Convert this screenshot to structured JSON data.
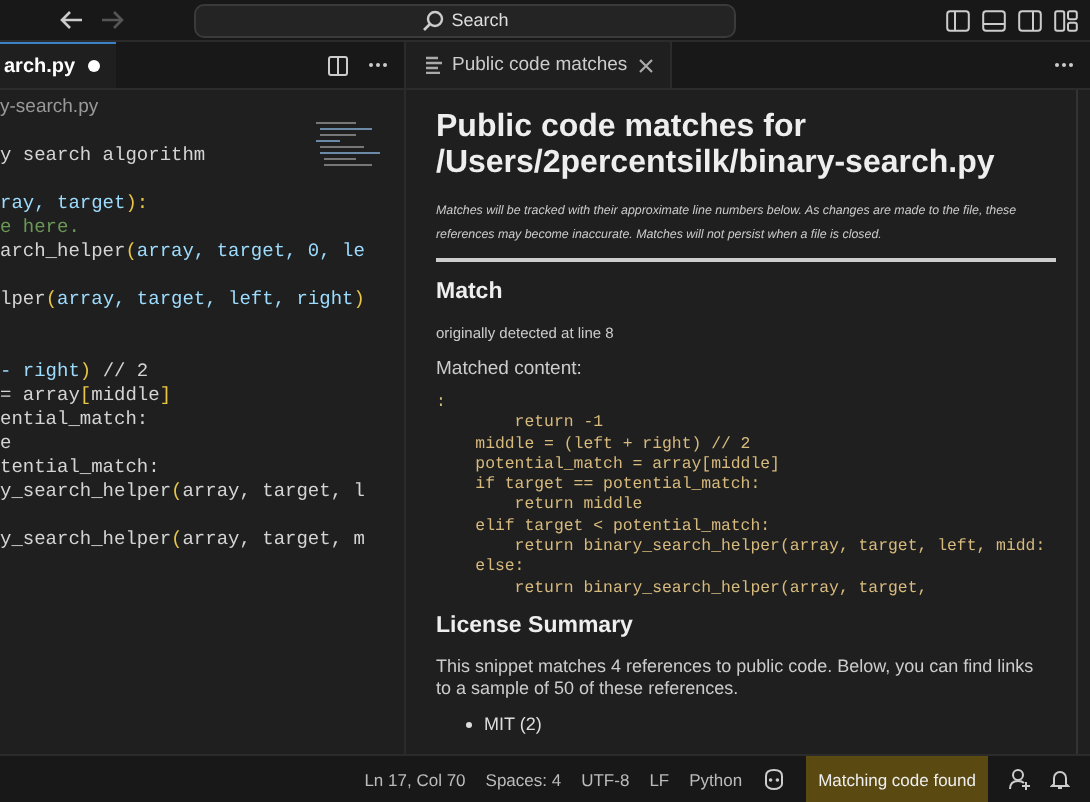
{
  "title_bar": {
    "search_placeholder": "Search",
    "back_disabled": false,
    "forward_disabled": true
  },
  "editor": {
    "tab": {
      "label": "arch.py",
      "modified": true,
      "selected": true
    },
    "breadcrumb": "y-search.py",
    "lines": [
      {
        "kind": "code",
        "segments": [
          {
            "text": "y search algorithm",
            "kind": "plain"
          }
        ]
      },
      {
        "kind": "blank"
      },
      {
        "kind": "code",
        "segments": [
          {
            "text": "ray, target",
            "kind": "param"
          },
          {
            "text": "):",
            "kind": "bracket"
          }
        ]
      },
      {
        "kind": "code",
        "segments": [
          {
            "text": "e here.",
            "kind": "comment"
          }
        ]
      },
      {
        "kind": "code",
        "segments": [
          {
            "text": "arch_helper",
            "kind": "plain"
          },
          {
            "text": "(",
            "kind": "bracket"
          },
          {
            "text": "array, target, 0, le",
            "kind": "param"
          }
        ]
      },
      {
        "kind": "blank"
      },
      {
        "kind": "code",
        "segments": [
          {
            "text": "lper",
            "kind": "plain"
          },
          {
            "text": "(",
            "kind": "bracket"
          },
          {
            "text": "array, target, left, right",
            "kind": "param"
          },
          {
            "text": ")",
            "kind": "bracket"
          }
        ]
      },
      {
        "kind": "blank"
      },
      {
        "kind": "blank"
      },
      {
        "kind": "code",
        "segments": [
          {
            "text": "- right",
            "kind": "param"
          },
          {
            "text": ")",
            "kind": "bracket"
          },
          {
            "text": " // 2",
            "kind": "plain"
          }
        ]
      },
      {
        "kind": "code",
        "segments": [
          {
            "text": "= array",
            "kind": "plain"
          },
          {
            "text": "[",
            "kind": "bracket"
          },
          {
            "text": "middle",
            "kind": "plain"
          },
          {
            "text": "]",
            "kind": "bracket"
          }
        ]
      },
      {
        "kind": "code",
        "segments": [
          {
            "text": "ential_match:",
            "kind": "plain"
          }
        ]
      },
      {
        "kind": "code",
        "segments": [
          {
            "text": "e",
            "kind": "plain"
          }
        ]
      },
      {
        "kind": "code",
        "segments": [
          {
            "text": "tential_match:",
            "kind": "plain"
          }
        ]
      },
      {
        "kind": "code",
        "segments": [
          {
            "text": "y_search_helper",
            "kind": "plain"
          },
          {
            "text": "(",
            "kind": "bracket"
          },
          {
            "text": "array, target, l",
            "kind": "plain"
          }
        ]
      },
      {
        "kind": "blank"
      },
      {
        "kind": "code",
        "segments": [
          {
            "text": "y_search_helper",
            "kind": "plain"
          },
          {
            "text": "(",
            "kind": "bracket"
          },
          {
            "text": "array, target, m",
            "kind": "plain"
          }
        ]
      }
    ]
  },
  "panel": {
    "tab": {
      "label": "Public code matches",
      "selected": true
    },
    "title": "Public code matches for /Users/2percentsilk/binary-search.py",
    "note": "Matches will be tracked with their approximate line numbers below. As changes are made to the file, these references may become inaccurate. Matches will not persist when a file is closed.",
    "match_heading": "Match",
    "detected": "originally detected at line 8",
    "matched_label": "Matched content:",
    "code": [
      ":",
      "        return -1",
      "    middle = (left + right) // 2",
      "    potential_match = array[middle]",
      "    if target == potential_match:",
      "        return middle",
      "    elif target < potential_match:",
      "        return binary_search_helper(array, target, left, midd:",
      "    else:",
      "        return binary_search_helper(array, target,"
    ],
    "license_heading": "License Summary",
    "license_text": "This snippet matches 4 references to public code. Below, you can find links to a sample of 50 of these references.",
    "licenses": [
      "MIT (2)"
    ]
  },
  "status_bar": {
    "items": [
      "Ln 17, Col 70",
      "Spaces: 4",
      "UTF-8",
      "LF",
      "Python"
    ],
    "notice": "Matching code found"
  }
}
